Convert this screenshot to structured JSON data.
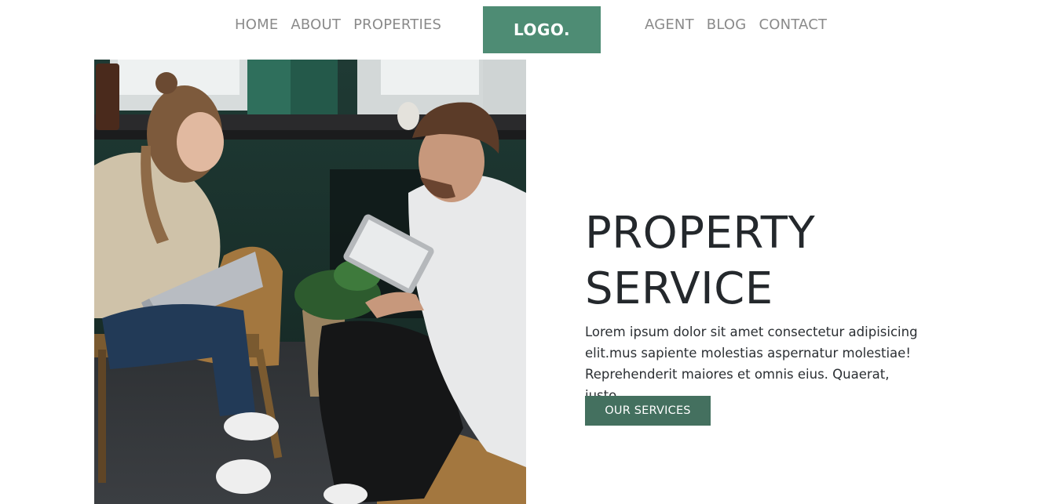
{
  "nav": {
    "left_links": [
      "HOME",
      "ABOUT",
      "PROPERTIES"
    ],
    "logo": "LOGO.",
    "right_links": [
      "AGENT",
      "BLOG",
      "CONTACT"
    ]
  },
  "hero": {
    "title_line1": "PROPERTY",
    "title_line2": "SERVICE",
    "description": "Lorem ipsum dolor sit amet consectetur adipisicing elit.mus sapiente molestias aspernatur molestiae! Reprehenderit maiores et omnis eius. Quaerat, iusto..",
    "button_label": "OUR SERVICES"
  },
  "colors": {
    "logo_bg": "#4e8c74",
    "button_bg": "#44705f",
    "nav_text": "#8a8a8a",
    "heading_text": "#24282c"
  }
}
